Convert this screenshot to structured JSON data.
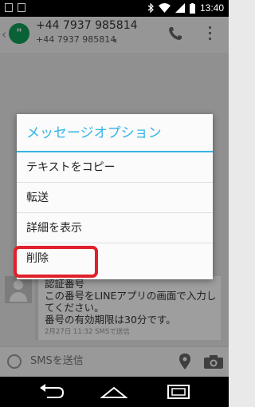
{
  "status_bar": {
    "time": "13:40"
  },
  "action_bar": {
    "title": "+44 7937 985814",
    "subtitle": "+44 7937 985814"
  },
  "message": {
    "lines": [
      "認証番号",
      "この番号をLINEアプリの画面で入力し",
      "てください。",
      "番号の有効期限は30分です。"
    ],
    "meta": "2月27日 11:32 SMSで送信"
  },
  "compose": {
    "placeholder": "SMSを送信"
  },
  "dialog": {
    "title": "メッセージオプション",
    "items": [
      {
        "label": "テキストをコピー"
      },
      {
        "label": "転送"
      },
      {
        "label": "詳細を表示"
      },
      {
        "label": "削除"
      }
    ]
  },
  "colors": {
    "accent": "#33b5e5",
    "highlight": "#e0202a",
    "app_green": "#0f9d58"
  }
}
